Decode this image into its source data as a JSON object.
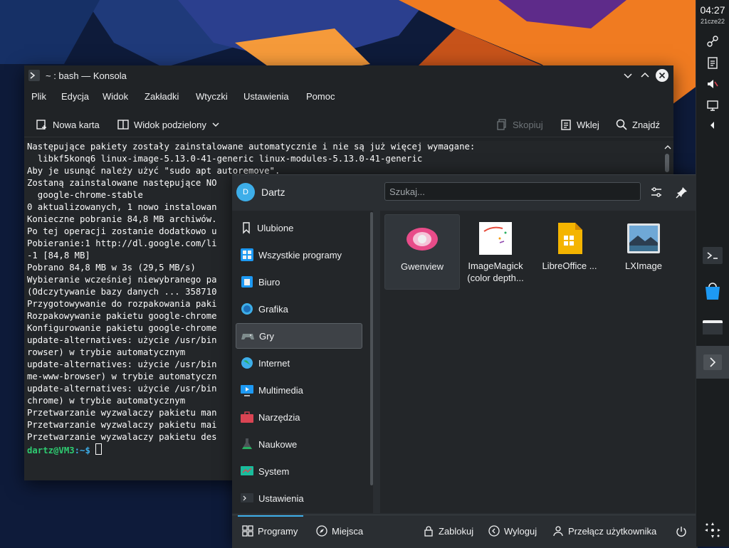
{
  "panel": {
    "time": "04:27",
    "date": "21cze22",
    "tray_icons": [
      "network-icon",
      "clipboard-icon",
      "volume-muted-icon",
      "display-icon",
      "expand-tray-icon"
    ],
    "launcher_icon": "app-launcher-icon"
  },
  "konsole": {
    "title": "~ : bash — Konsola",
    "menu": [
      "Plik",
      "Edycja",
      "Widok",
      "Zakładki",
      "Wtyczki",
      "Ustawienia",
      "Pomoc"
    ],
    "toolbar": {
      "new_tab": "Nowa karta",
      "split_view": "Widok podzielony",
      "copy": "Skopiuj",
      "paste": "Wklej",
      "find": "Znajdź"
    },
    "lines": [
      "Następujące pakiety zostały zainstalowane automatycznie i nie są już więcej wymagane:",
      "  libkf5konq6 linux-image-5.13.0-41-generic linux-modules-5.13.0-41-generic",
      "Aby je usunąć należy użyć \"sudo apt autoremove\".",
      "Zostaną zainstalowane następujące NO",
      "  google-chrome-stable",
      "0 aktualizowanych, 1 nowo instalowan",
      "Konieczne pobranie 84,8 MB archiwów.",
      "Po tej operacji zostanie dodatkowo u",
      "Pobieranie:1 http://dl.google.com/li",
      "-1 [84,8 MB]",
      "Pobrano 84,8 MB w 3s (29,5 MB/s)",
      "Wybieranie wcześniej niewybranego pa",
      "(Odczytywanie bazy danych ... 358710",
      "Przygotowywanie do rozpakowania paki",
      "Rozpakowywanie pakietu google-chrome",
      "Konfigurowanie pakietu google-chrome",
      "update-alternatives: użycie /usr/bin",
      "rowser) w trybie automatycznym",
      "update-alternatives: użycie /usr/bin",
      "me-www-browser) w trybie automatyczn",
      "update-alternatives: użycie /usr/bin",
      "chrome) w trybie automatycznym",
      "Przetwarzanie wyzwalaczy pakietu man",
      "Przetwarzanie wyzwalaczy pakietu mai",
      "Przetwarzanie wyzwalaczy pakietu des"
    ],
    "prompt_user": "dartz@VM3",
    "prompt_path": ":~$"
  },
  "launcher": {
    "user": "Dartz",
    "avatar_letter": "D",
    "search_placeholder": "Szukaj...",
    "categories": [
      {
        "label": "Ulubione",
        "icon": "bookmark-icon"
      },
      {
        "label": "Wszystkie programy",
        "icon": "all-apps-icon"
      },
      {
        "label": "Biuro",
        "icon": "office-icon"
      },
      {
        "label": "Grafika",
        "icon": "graphics-icon"
      },
      {
        "label": "Gry",
        "icon": "gamepad-icon"
      },
      {
        "label": "Internet",
        "icon": "globe-icon"
      },
      {
        "label": "Multimedia",
        "icon": "multimedia-icon"
      },
      {
        "label": "Narzędzia",
        "icon": "toolbox-icon"
      },
      {
        "label": "Naukowe",
        "icon": "flask-icon"
      },
      {
        "label": "System",
        "icon": "system-icon"
      },
      {
        "label": "Ustawienia",
        "icon": "settings-icon"
      }
    ],
    "selected_category": "Gry",
    "apps": [
      {
        "label": "Gwenview",
        "icon": "gwenview-icon"
      },
      {
        "label": "ImageMagick (color depth...",
        "icon": "imagemagick-icon"
      },
      {
        "label": "LibreOffice ...",
        "icon": "libreoffice-draw-icon"
      },
      {
        "label": "LXImage",
        "icon": "lximage-icon"
      }
    ],
    "footer": {
      "programs": "Programy",
      "places": "Miejsca",
      "lock": "Zablokuj",
      "logout": "Wyloguj",
      "switch_user": "Przełącz użytkownika"
    }
  }
}
